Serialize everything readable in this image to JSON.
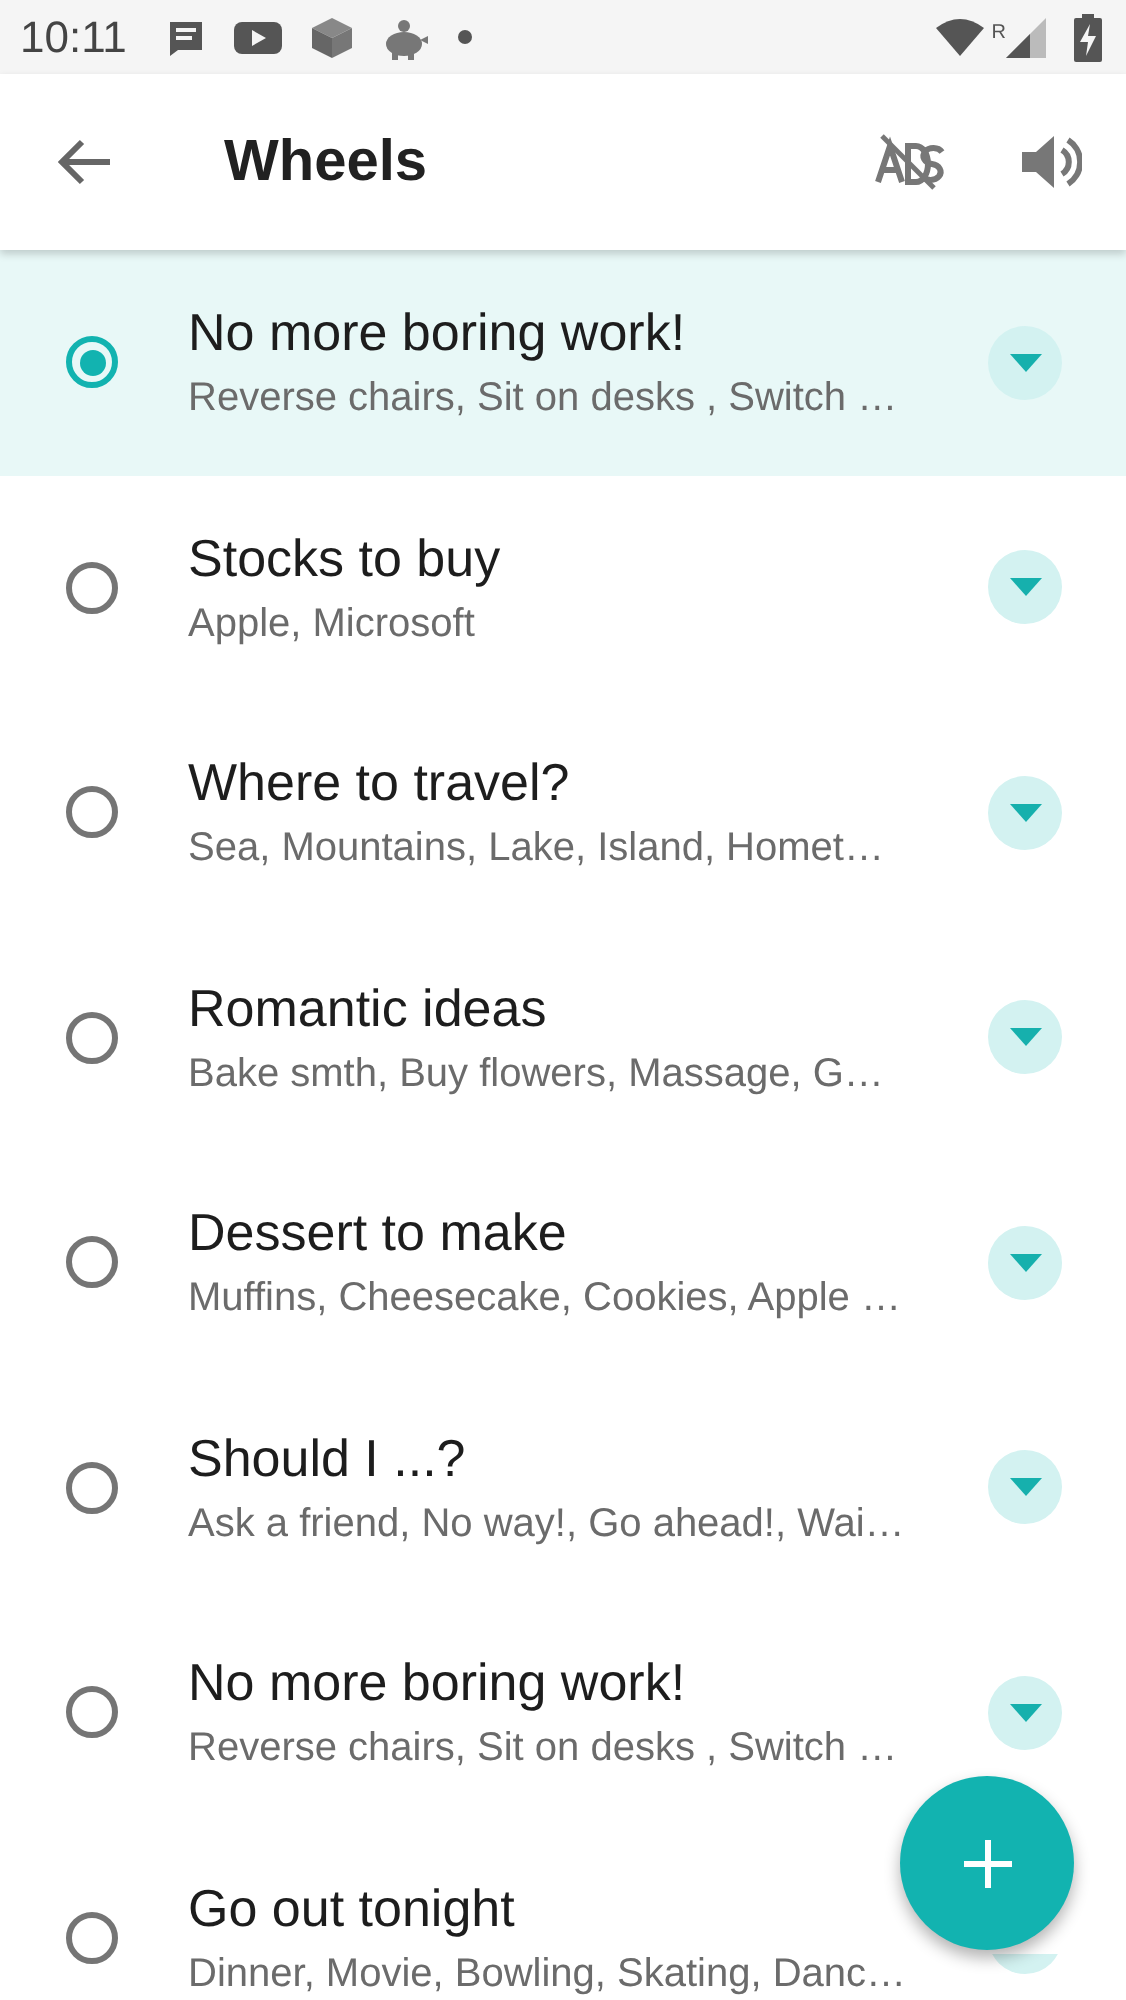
{
  "status_bar": {
    "time": "10:11",
    "roaming": "R"
  },
  "app_bar": {
    "title": "Wheels"
  },
  "wheels": [
    {
      "title": "No more boring work!",
      "subtitle": "Reverse chairs, Sit on desks , Switch …",
      "selected": true
    },
    {
      "title": "Stocks to buy",
      "subtitle": "Apple, Microsoft",
      "selected": false
    },
    {
      "title": "Where to travel?",
      "subtitle": "Sea, Mountains, Lake, Island, Homet…",
      "selected": false
    },
    {
      "title": "Romantic ideas",
      "subtitle": "Bake smth, Buy flowers, Massage, G…",
      "selected": false
    },
    {
      "title": "Dessert to make",
      "subtitle": "Muffins, Cheesecake, Cookies, Apple …",
      "selected": false
    },
    {
      "title": "Should I ...?",
      "subtitle": "Ask a friend, No way!, Go ahead!, Wai…",
      "selected": false
    },
    {
      "title": "No more boring work!",
      "subtitle": "Reverse chairs, Sit on desks , Switch …",
      "selected": false
    },
    {
      "title": "Go out tonight",
      "subtitle": "Dinner, Movie, Bowling, Skating, Danc…",
      "selected": false
    }
  ]
}
